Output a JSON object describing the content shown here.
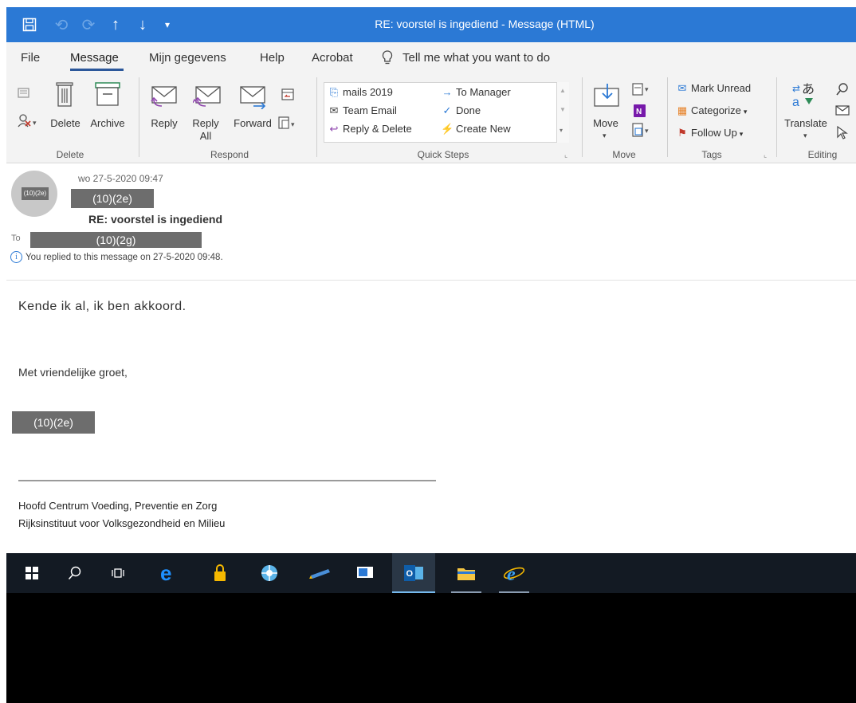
{
  "window": {
    "title": "RE: voorstel is ingediend  -  Message (HTML)"
  },
  "menu": {
    "file": "File",
    "message": "Message",
    "mijn_gegevens": "Mijn gegevens",
    "help": "Help",
    "acrobat": "Acrobat",
    "tell_me": "Tell me what you want to do"
  },
  "ribbon": {
    "delete_group": {
      "delete": "Delete",
      "archive": "Archive",
      "label": "Delete"
    },
    "respond_group": {
      "reply": "Reply",
      "reply_all_1": "Reply",
      "reply_all_2": "All",
      "forward": "Forward",
      "label": "Respond"
    },
    "quick_steps": {
      "items": [
        "mails 2019",
        "To Manager",
        "Team Email",
        "Done",
        "Reply & Delete",
        "Create New"
      ],
      "label": "Quick Steps"
    },
    "move_group": {
      "move": "Move",
      "label": "Move"
    },
    "tags_group": {
      "mark_unread": "Mark Unread",
      "categorize": "Categorize",
      "follow_up": "Follow Up",
      "label": "Tags"
    },
    "editing_group": {
      "translate": "Translate",
      "label": "Editing"
    }
  },
  "message": {
    "avatar_text": "(10)(2e)",
    "date": "wo 27-5-2020 09:47",
    "sender": "(10)(2e)",
    "subject": "RE: voorstel is ingediend",
    "to_label": "To",
    "to_value": "(10)(2g)",
    "replied_notice": "You replied to this message on 27-5-2020 09:48."
  },
  "body": {
    "line1": "Kende ik al, ik ben akkoord.",
    "line2": "Met vriendelijke groet,",
    "signer": "(10)(2e)",
    "sig1": "Hoofd Centrum Voeding, Preventie en Zorg",
    "sig2": "Rijksinstituut voor Volksgezondheid en Milieu"
  },
  "colors": {
    "titlebar": "#2b79d5",
    "ribbon": "#f3f3f3",
    "taskbar": "#131a23"
  }
}
